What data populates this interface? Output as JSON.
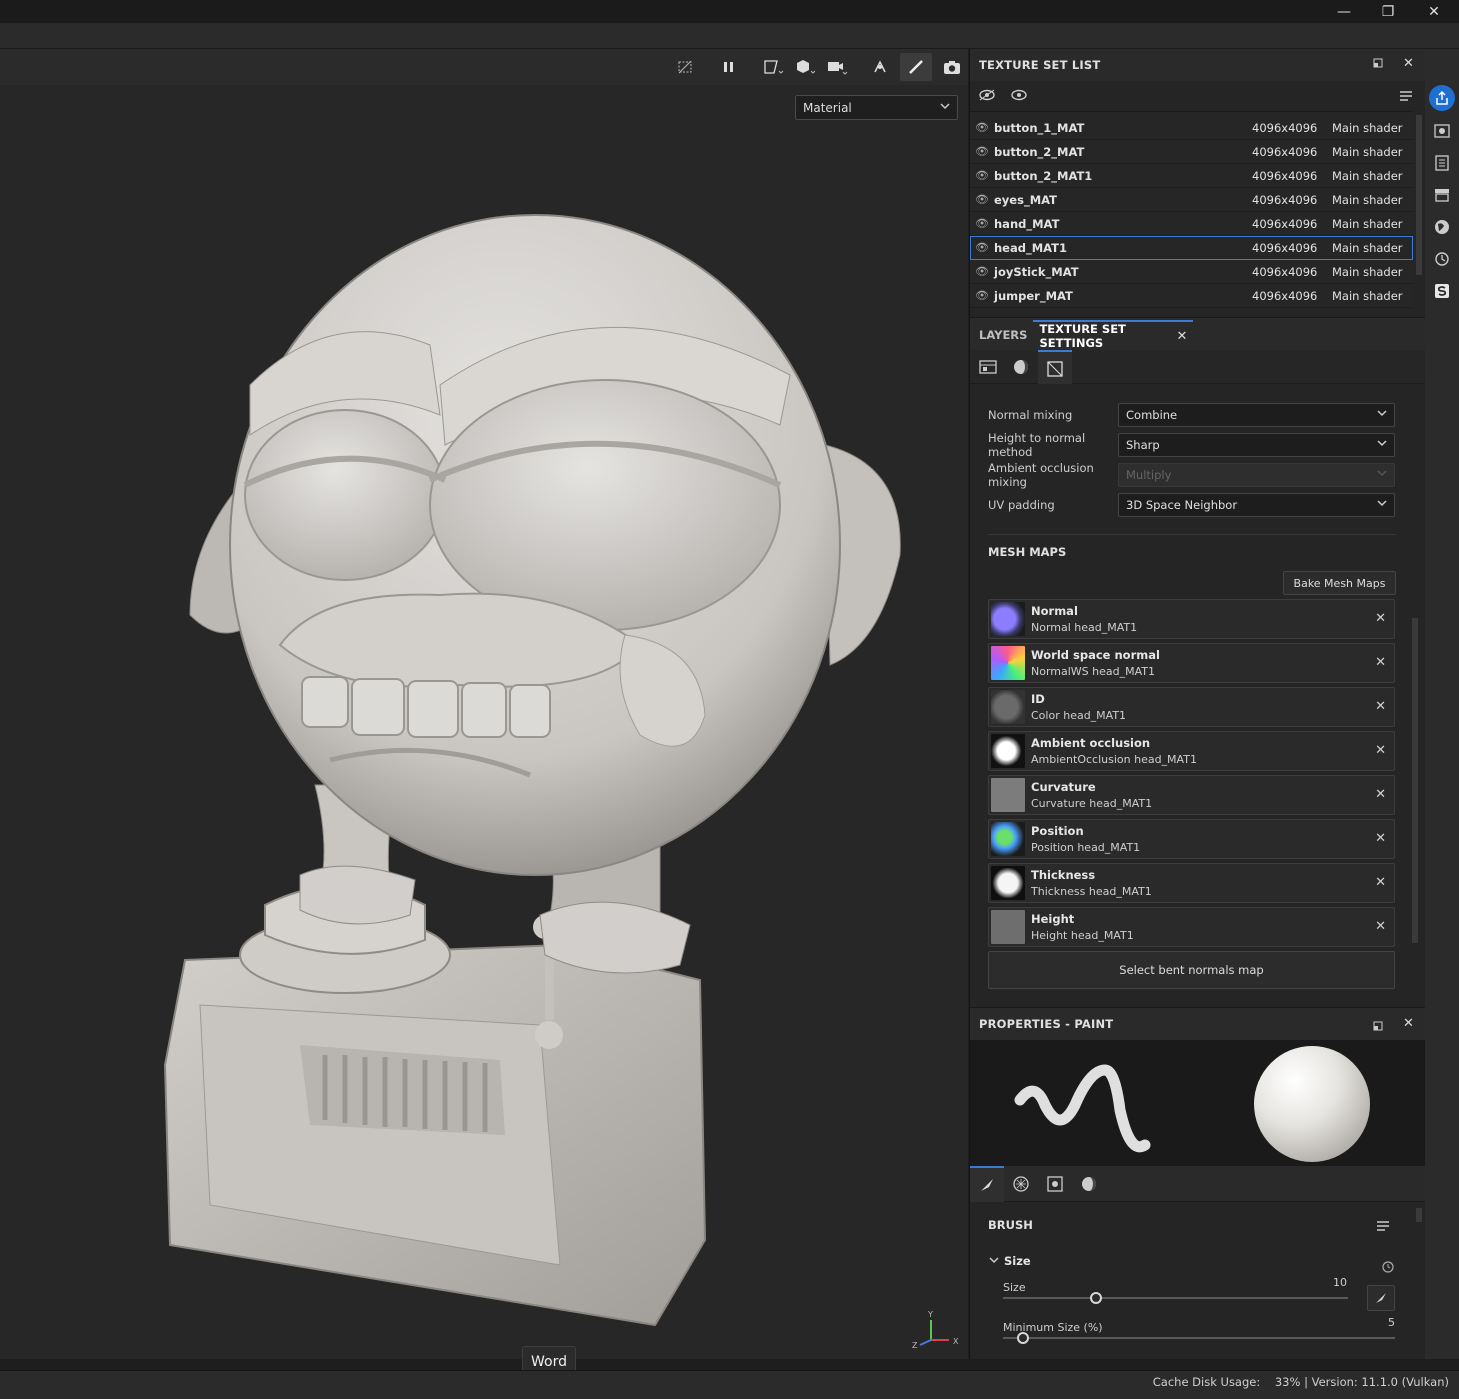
{
  "window": {
    "minimize_glyph": "—",
    "restore_glyph": "❐",
    "close_glyph": "✕"
  },
  "viewport": {
    "material_dropdown": "Material",
    "axis_labels": {
      "y": "Y",
      "x": "X",
      "z": "Z"
    }
  },
  "texture_set_list": {
    "title": "TEXTURE SET LIST",
    "rows": [
      {
        "name": "button_1_MAT",
        "resolution": "4096x4096",
        "shader": "Main shader"
      },
      {
        "name": "button_2_MAT",
        "resolution": "4096x4096",
        "shader": "Main shader"
      },
      {
        "name": "button_2_MAT1",
        "resolution": "4096x4096",
        "shader": "Main shader"
      },
      {
        "name": "eyes_MAT",
        "resolution": "4096x4096",
        "shader": "Main shader"
      },
      {
        "name": "hand_MAT",
        "resolution": "4096x4096",
        "shader": "Main shader"
      },
      {
        "name": "head_MAT1",
        "resolution": "4096x4096",
        "shader": "Main shader"
      },
      {
        "name": "joyStick_MAT",
        "resolution": "4096x4096",
        "shader": "Main shader"
      },
      {
        "name": "jumper_MAT",
        "resolution": "4096x4096",
        "shader": "Main shader"
      }
    ],
    "selected_index": 5
  },
  "tabs": {
    "layers": "LAYERS",
    "texture_set_settings": "TEXTURE SET SETTINGS"
  },
  "settings": {
    "normal_mixing": {
      "label": "Normal mixing",
      "value": "Combine"
    },
    "height_to_normal": {
      "label": "Height to normal method",
      "value": "Sharp"
    },
    "ao_mixing": {
      "label": "Ambient occlusion mixing",
      "value": "Multiply"
    },
    "uv_padding": {
      "label": "UV padding",
      "value": "3D Space Neighbor"
    }
  },
  "mesh_maps": {
    "title": "MESH MAPS",
    "bake_button": "Bake Mesh Maps",
    "items": [
      {
        "title": "Normal",
        "sub": "Normal head_MAT1"
      },
      {
        "title": "World space normal",
        "sub": "NormalWS head_MAT1"
      },
      {
        "title": "ID",
        "sub": "Color head_MAT1"
      },
      {
        "title": "Ambient occlusion",
        "sub": "AmbientOcclusion head_MAT1"
      },
      {
        "title": "Curvature",
        "sub": "Curvature head_MAT1"
      },
      {
        "title": "Position",
        "sub": "Position head_MAT1"
      },
      {
        "title": "Thickness",
        "sub": "Thickness head_MAT1"
      },
      {
        "title": "Height",
        "sub": "Height head_MAT1"
      }
    ],
    "bent_normals_button": "Select bent normals map"
  },
  "properties": {
    "title": "PROPERTIES - PAINT",
    "brush_title": "BRUSH",
    "size_group": "Size",
    "size_label": "Size",
    "size_value": "10",
    "size_fraction": 0.27,
    "min_size_label": "Minimum Size (%)",
    "min_size_value": "5",
    "min_size_fraction": 0.05
  },
  "tooltip": "Word",
  "status": {
    "text": "Cache Disk Usage:    33% | Version: 11.1.0 (Vulkan)"
  },
  "colors": {
    "accent": "#3a7bd5",
    "sidebar_active": "#1f6fd1"
  }
}
